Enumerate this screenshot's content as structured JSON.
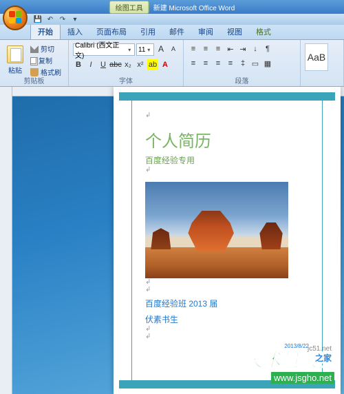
{
  "titlebar": {
    "draw_tools": "绘图工具",
    "title": "新建 Microsoft Office Word"
  },
  "tabs": {
    "home": "开始",
    "insert": "插入",
    "layout": "页面布局",
    "ref": "引用",
    "mail": "邮件",
    "review": "审阅",
    "view": "视图",
    "format": "格式"
  },
  "clipboard": {
    "paste": "粘贴",
    "cut": "剪切",
    "copy": "复制",
    "brush": "格式刷",
    "label": "剪贴板"
  },
  "font": {
    "name": "Calibri (西文正文)",
    "size": "11",
    "label": "字体"
  },
  "paragraph": {
    "label": "段落"
  },
  "styles": {
    "sample": "AaB"
  },
  "document": {
    "title": "个人简历",
    "subtitle": "百度经验专用",
    "line1": "百度经验班 2013 届",
    "line2": "伏素书生",
    "date": "2013/8/22"
  },
  "watermark": {
    "brand": "技术员联盟",
    "url": "www.jsgho.net",
    "url2": "jc51.net",
    "site": "之家"
  }
}
